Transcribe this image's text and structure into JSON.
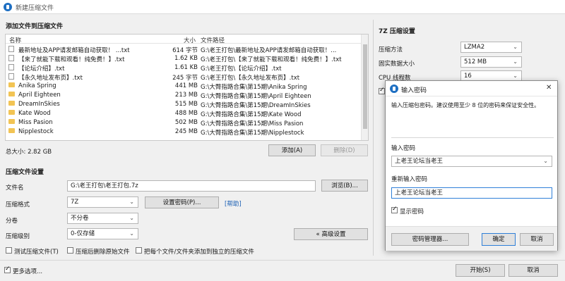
{
  "window": {
    "title": "新建压缩文件"
  },
  "add_section": {
    "title": "添加文件到压缩文件",
    "columns": {
      "name": "名称",
      "size": "大小",
      "path": "文件路径"
    },
    "rows": [
      {
        "name": "最新地址及APP请发邮箱自动获取！ ...txt",
        "size": "614 字节",
        "path": "G:\\老王打包\\最新地址及APP请发邮箱自动获取！...",
        "type": "file"
      },
      {
        "name": "【来了就能下载和观看！纯免费！】.txt",
        "size": "1.62 KB",
        "path": "G:\\老王打包\\【来了就能下载和观看！纯免费！】.txt",
        "type": "file"
      },
      {
        "name": "【论坛介绍】.txt",
        "size": "1.61 KB",
        "path": "G:\\老王打包\\【论坛介绍】.txt",
        "type": "file"
      },
      {
        "name": "【永久地址发布页】.txt",
        "size": "245 字节",
        "path": "G:\\老王打包\\【永久地址发布页】.txt",
        "type": "file"
      },
      {
        "name": "Anika Spring",
        "size": "441 MB",
        "path": "G:\\大臀指路合集\\第15期\\Anika Spring",
        "type": "folder"
      },
      {
        "name": "April Eighteen",
        "size": "213 MB",
        "path": "G:\\大臀指路合集\\第15期\\April Eighteen",
        "type": "folder"
      },
      {
        "name": "DreamInSkies",
        "size": "515 MB",
        "path": "G:\\大臀指路合集\\第15期\\DreamInSkies",
        "type": "folder"
      },
      {
        "name": "Kate Wood",
        "size": "488 MB",
        "path": "G:\\大臀指路合集\\第15期\\Kate Wood",
        "type": "folder"
      },
      {
        "name": "Miss Pasion",
        "size": "502 MB",
        "path": "G:\\大臀指路合集\\第15期\\Miss Pasion",
        "type": "folder"
      },
      {
        "name": "Nipplestock",
        "size": "245 MB",
        "path": "G:\\大臀指路合集\\第15期\\Nipplestock",
        "type": "folder"
      }
    ],
    "total_size": "总大小: 2.82 GB",
    "add_button": "添加(A)",
    "delete_button": "删除(D)"
  },
  "settings_section": {
    "title": "压缩文件设置",
    "filename_label": "文件名",
    "filename_value": "G:\\老王打包\\老王打包.7z",
    "browse_button": "浏览(B)...",
    "format_label": "压缩格式",
    "format_value": "7Z",
    "set_password_button": "设置密码(P)...",
    "help_link": "[帮助]",
    "split_label": "分卷",
    "split_value": "不分卷",
    "level_label": "压缩级别",
    "level_value": "0-仅存储",
    "advanced_button": "« 高级设置",
    "test_checkbox": "测试压缩文件(T)",
    "delete_source_checkbox": "压缩后删除原始文件",
    "separate_checkbox": "把每个文件/文件夹添加到独立的压缩文件"
  },
  "bottom": {
    "more_options": "更多选项...",
    "start_button": "开始(S)",
    "cancel_button": "取消"
  },
  "sevenz_panel": {
    "title": "7Z 压缩设置",
    "method_label": "压缩方法",
    "method_value": "LZMA2",
    "solid_label": "固实数据大小",
    "solid_value": "512 MB",
    "threads_label": "CPU 线程数",
    "threads_value": "16"
  },
  "password_dialog": {
    "title": "输入密码",
    "description": "输入压缩包密码。建议使用至少 8 位的密码来保证安全性。",
    "password_label": "输入密码",
    "password_value": "上老王论坛当老王",
    "confirm_label": "重新输入密码",
    "confirm_value": "上老王论坛当老王",
    "show_password": "显示密码",
    "manager_button": "密码管理器...",
    "ok_button": "确定",
    "cancel_button": "取消",
    "close_symbol": "✕"
  }
}
